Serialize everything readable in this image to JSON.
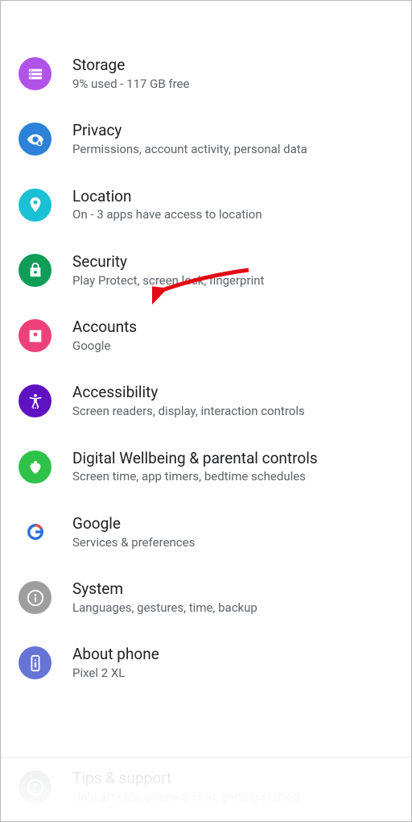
{
  "arrow_target": "security",
  "settings": {
    "items": [
      {
        "key": "storage",
        "title": "Storage",
        "subtitle": "9% used - 117 GB free",
        "icon": "storage-icon",
        "color": "c-storage"
      },
      {
        "key": "privacy",
        "title": "Privacy",
        "subtitle": "Permissions, account activity, personal data",
        "icon": "eye-lock-icon",
        "color": "c-privacy"
      },
      {
        "key": "location",
        "title": "Location",
        "subtitle": "On - 3 apps have access to location",
        "icon": "location-pin-icon",
        "color": "c-location"
      },
      {
        "key": "security",
        "title": "Security",
        "subtitle": "Play Protect, screen lock, fingerprint",
        "icon": "lock-icon",
        "color": "c-security"
      },
      {
        "key": "accounts",
        "title": "Accounts",
        "subtitle": "Google",
        "icon": "account-box-icon",
        "color": "c-accounts"
      },
      {
        "key": "accessibility",
        "title": "Accessibility",
        "subtitle": "Screen readers, display, interaction controls",
        "icon": "accessibility-icon",
        "color": "c-accessibility"
      },
      {
        "key": "wellbeing",
        "title": "Digital Wellbeing & parental controls",
        "subtitle": "Screen time, app timers, bedtime schedules",
        "icon": "wellbeing-icon",
        "color": "c-wellbeing"
      },
      {
        "key": "google",
        "title": "Google",
        "subtitle": "Services & preferences",
        "icon": "google-g-icon",
        "color": "c-google"
      },
      {
        "key": "system",
        "title": "System",
        "subtitle": "Languages, gestures, time, backup",
        "icon": "info-icon",
        "color": "c-system"
      },
      {
        "key": "about",
        "title": "About phone",
        "subtitle": "Pixel 2 XL",
        "icon": "phone-icon",
        "color": "c-about"
      }
    ]
  },
  "faded_item": {
    "key": "tips",
    "title": "Tips & support",
    "subtitle": "Help articles, phone & chat, getting started",
    "icon": "help-icon",
    "color": "c-tips"
  }
}
